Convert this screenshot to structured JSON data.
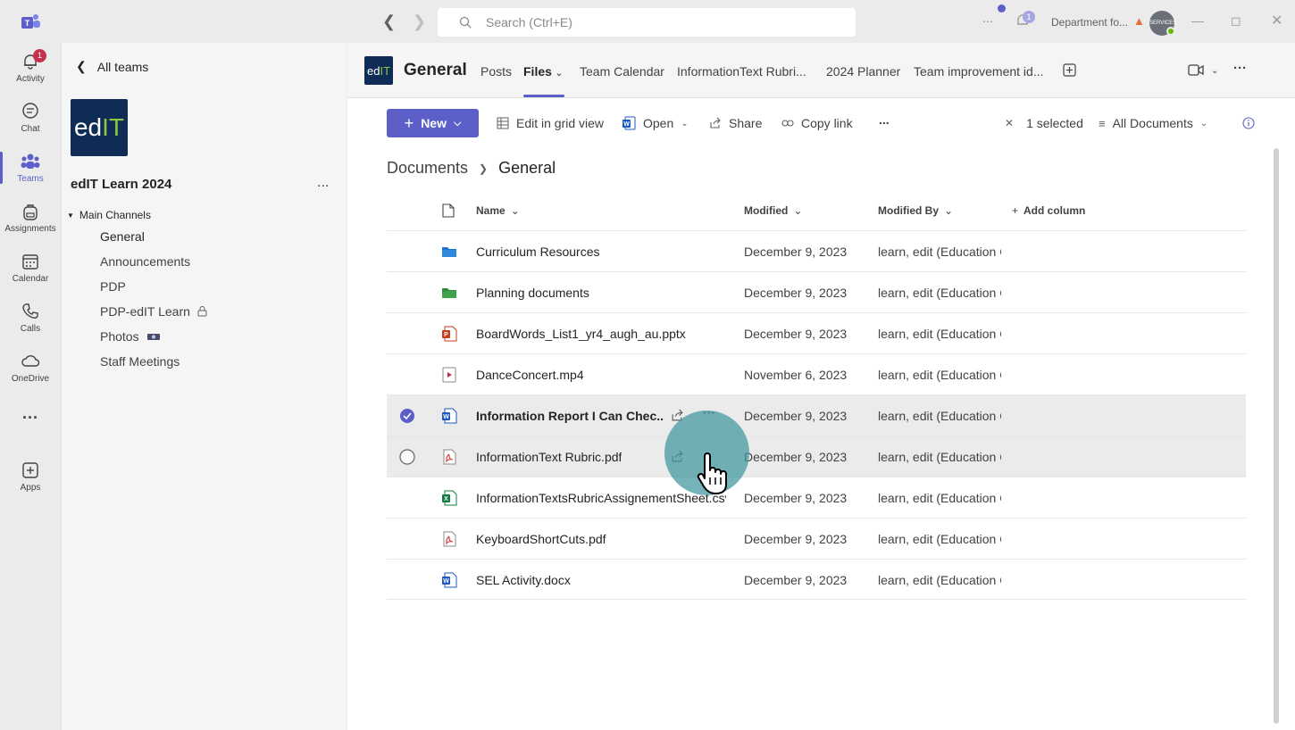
{
  "titlebar": {
    "search_placeholder": "Search (Ctrl+E)",
    "more": "...",
    "notification_count": "1",
    "org": "Department fo...",
    "avatar_text": "SERVICES"
  },
  "rail": [
    {
      "label": "Activity",
      "icon": "bell-icon",
      "badge": "1"
    },
    {
      "label": "Chat",
      "icon": "chat-icon"
    },
    {
      "label": "Teams",
      "icon": "teams-icon"
    },
    {
      "label": "Assignments",
      "icon": "backpack-icon"
    },
    {
      "label": "Calendar",
      "icon": "calendar-icon"
    },
    {
      "label": "Calls",
      "icon": "phone-icon"
    },
    {
      "label": "OneDrive",
      "icon": "cloud-icon"
    },
    {
      "label": "",
      "icon": "more-icon"
    },
    {
      "label": "Apps",
      "icon": "add-app-icon"
    }
  ],
  "sidebar": {
    "back_label": "All teams",
    "logo_text_a": "ed",
    "logo_text_b": "IT",
    "team_name": "edIT Learn 2024",
    "more": "...",
    "section": "Main Channels",
    "channels": [
      "General",
      "Announcements",
      "PDP",
      "PDP-edIT Learn",
      "Photos",
      "Staff Meetings"
    ]
  },
  "channel": {
    "logo_a": "ed",
    "logo_b": "IT",
    "title": "General",
    "tabs": [
      "Posts",
      "Files",
      "Team Calendar",
      "InformationText Rubri...",
      "2024 Planner",
      "Team improvement id..."
    ]
  },
  "toolbar": {
    "new": "New",
    "edit_grid": "Edit in grid view",
    "open": "Open",
    "share": "Share",
    "copy_link": "Copy link",
    "more": "...",
    "selected": "1 selected",
    "view": "All Documents"
  },
  "breadcrumb": {
    "root": "Documents",
    "current": "General"
  },
  "columns": {
    "name": "Name",
    "modified": "Modified",
    "modified_by": "Modified By",
    "add": "Add column"
  },
  "files": [
    {
      "name": "Curriculum Resources",
      "type": "folder-blue",
      "modified": "December 9, 2023",
      "by": "learn, edit (Education C"
    },
    {
      "name": "Planning documents",
      "type": "folder-green",
      "modified": "December 9, 2023",
      "by": "learn, edit (Education C"
    },
    {
      "name": "BoardWords_List1_yr4_augh_au.pptx",
      "type": "pptx",
      "modified": "December 9, 2023",
      "by": "learn, edit (Education C"
    },
    {
      "name": "DanceConcert.mp4",
      "type": "video",
      "modified": "November 6, 2023",
      "by": "learn, edit (Education C"
    },
    {
      "name": "Information Report I Can Chec...",
      "type": "docx",
      "modified": "December 9, 2023",
      "by": "learn, edit (Education C"
    },
    {
      "name": "InformationText Rubric.pdf",
      "type": "pdf",
      "modified": "December 9, 2023",
      "by": "learn, edit (Education C"
    },
    {
      "name": "InformationTextsRubricAssignementSheet.csv",
      "type": "xlsx",
      "modified": "December 9, 2023",
      "by": "learn, edit (Education C"
    },
    {
      "name": "KeyboardShortCuts.pdf",
      "type": "pdf",
      "modified": "December 9, 2023",
      "by": "learn, edit (Education C"
    },
    {
      "name": "SEL Activity.docx",
      "type": "docx",
      "modified": "December 9, 2023",
      "by": "learn, edit (Education C"
    }
  ],
  "colors": {
    "accent": "#5b5fc7",
    "brand_dark": "#0f2c57",
    "brand_green": "#8dc63f"
  }
}
